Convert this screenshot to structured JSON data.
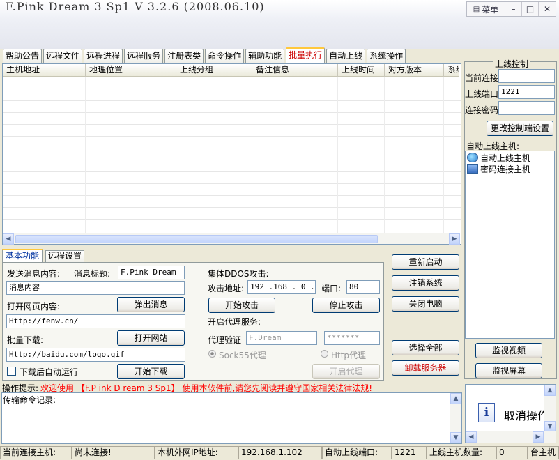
{
  "window": {
    "title": "F.Pink Dream 3 Sp1 V 3.2.6 (2008.06.10)",
    "menu_label": "菜单",
    "menu_icon": "list-icon",
    "minimize": "–",
    "maximize": "□",
    "close": "✕"
  },
  "tabs": [
    "帮助公告",
    "远程文件",
    "远程进程",
    "远程服务",
    "注册表类",
    "命令操作",
    "辅助功能",
    "批量执行",
    "自动上线",
    "系统操作"
  ],
  "active_tab": "批量执行",
  "grid": {
    "columns": [
      "主机地址",
      "地理位置",
      "上线分组",
      "备注信息",
      "上线时间",
      "对方版本",
      "系统"
    ],
    "rows": []
  },
  "online_control": {
    "title": "上线控制",
    "current_conn_label": "当前连接",
    "current_conn_value": "",
    "port_label": "上线端口",
    "port_value": "1221",
    "password_label": "连接密码",
    "password_value": "",
    "change_settings_button": "更改控制端设置",
    "auto_hosts_label": "自动上线主机:",
    "tree": [
      {
        "label": "自动上线主机",
        "icon": "globe-computer-icon"
      },
      {
        "label": "密码连接主机",
        "icon": "network-icon"
      }
    ]
  },
  "monitor": {
    "video_button": "监视视频",
    "screen_button": "监视屏幕"
  },
  "sub_tabs": [
    "基本功能",
    "远程设置"
  ],
  "active_sub_tab": "基本功能",
  "basic": {
    "send_msg_label": "发送消息内容:",
    "msg_title_label": "消息标题:",
    "msg_title_value": "F.Pink Dream",
    "msg_content_value": "消息内容",
    "popup_msg_button": "弹出消息",
    "open_web_label": "打开网页内容:",
    "web_url_value": "Http://fenw.cn/",
    "open_site_button": "打开网站",
    "batch_download_label": "批量下载:",
    "download_url_value": "Http://baidu.com/logo.gif",
    "auto_run_label": "下载后自动运行",
    "auto_run_checked": false,
    "start_download_button": "开始下载",
    "ddos_label": "集体DDOS攻击:",
    "attack_addr_label": "攻击地址:",
    "attack_addr_value": "192 .168 . 0  . 1",
    "port_label": "端口:",
    "port_value": "80",
    "start_attack_button": "开始攻击",
    "stop_attack_button": "停止攻击",
    "proxy_label": "开启代理服务:",
    "proxy_auth_label": "代理验证",
    "proxy_user_placeholder": "F.Dream",
    "proxy_pass_placeholder": "*******",
    "socks_label": "Sock55代理",
    "http_label": "Http代理",
    "start_proxy_button": "开启代理"
  },
  "system_buttons": {
    "restart": "重新启动",
    "logoff": "注销系统",
    "shutdown": "关闭电脑",
    "select_all": "选择全部",
    "uninstall": "卸载服务器"
  },
  "hint": {
    "label": "操作提示:",
    "text": "欢迎使用 【F.P ink D ream 3 Sp1】 使用本软件前,请您先阅读并遵守国家相关法律法规!"
  },
  "log": {
    "label": "传输命令记录:"
  },
  "cancel_op": {
    "text": "取消操作",
    "icon": "info-icon"
  },
  "statusbar": {
    "current_host_label": "当前连接主机:",
    "current_host_value": "尚未连接!",
    "ip_label": "本机外网IP地址:",
    "ip_value": "192.168.1.102",
    "auto_port_label": "自动上线端口:",
    "auto_port_value": "1221",
    "count_label": "上线主机数量:",
    "count_value": "0",
    "tail_label": "台主机"
  },
  "colors": {
    "accent_red": "#cc0000",
    "status_red": "#ff0000",
    "window_bg": "#ece9d8",
    "tab_highlight": "#ffc83c",
    "select_blue": "#316ac5"
  }
}
